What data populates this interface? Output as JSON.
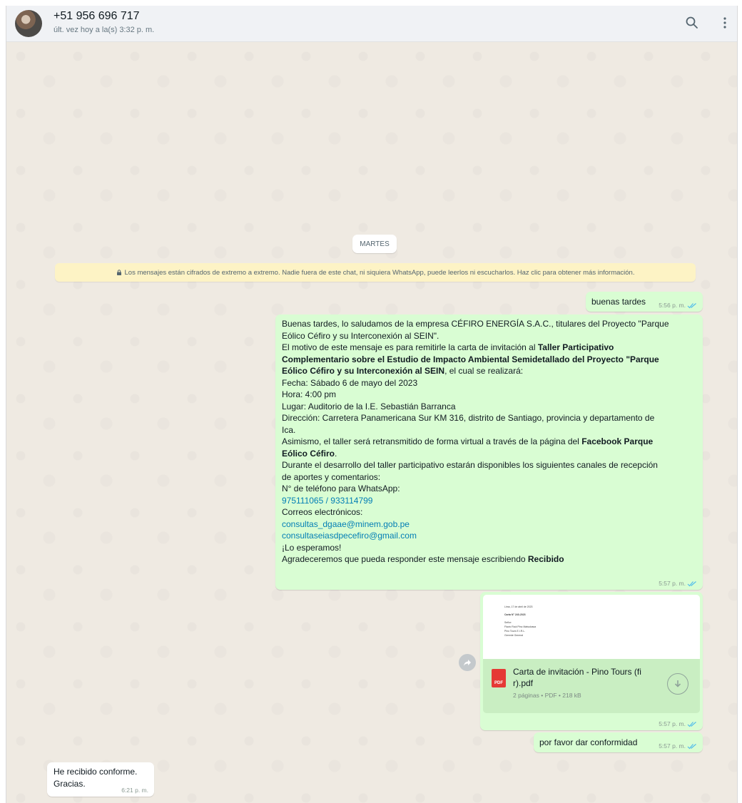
{
  "header": {
    "contact_name": "+51 956 696 717",
    "status": "últ. vez hoy a la(s) 3:32 p. m.",
    "search_icon": "search-icon",
    "menu_icon": "more-vertical-icon"
  },
  "chat": {
    "day_label": "MARTES",
    "encryption_notice": "Los mensajes están cifrados de extremo a extremo. Nadie fuera de este chat, ni siquiera WhatsApp, puede leerlos ni escucharlos. Haz clic para obtener más información.",
    "messages": [
      {
        "text": "buenas tardes",
        "time": "5:56 p. m."
      },
      {
        "lines": [
          "Buenas tardes, lo saludamos de la empresa CÉFIRO ENERGÍA S.A.C., titulares del Proyecto \"Parque",
          "Eólico Céfiro y su Interconexión al SEIN\".",
          "El motivo de este mensaje es para remitirle la carta de invitación al ",
          "Taller Participativo",
          "Complementario sobre el Estudio de Impacto Ambiental Semidetallado del Proyecto \"Parque",
          "Eólico Céfiro y su Interconexión al SEIN",
          ", el cual se realizará:",
          "Fecha: Sábado 6 de mayo del 2023",
          "Hora: 4:00 pm",
          "Lugar:  Auditorio de la I.E. Sebastián Barranca",
          "Dirección: Carretera Panamericana Sur KM 316, distrito de Santiago, provincia y departamento de",
          "Ica.",
          "Asimismo, el taller será retransmitido de forma virtual a través de la página del ",
          "Facebook Parque",
          "Eólico Céfiro",
          ".",
          "Durante el desarrollo del taller participativo estarán disponibles los siguientes canales de recepción",
          "de aportes y comentarios:",
          "N° de teléfono para WhatsApp:",
          "975111065 / 933114799",
          "Correos electrónicos:",
          "consultas_dgaae@minem.gob.pe",
          "consultaseiasdpecefiro@gmail.com",
          "¡Lo esperamos!",
          "Agradeceremos que pueda responder este mensaje escribiendo ",
          "Recibido"
        ],
        "time": "5:57 p. m."
      },
      {
        "document": {
          "name": "Carta de invitación - Pino Tours (fi r).pdf",
          "info": "2 páginas • PDF • 218 kB",
          "icon_label": "PDF",
          "preview_lines": [
            "Lima, 17 de abril de 2023",
            "Carta N° 240-2023",
            "Señor:",
            "Flavio Raúl Pino Matsukawa",
            "Pino Tours E.I.R.L.",
            "Gerente General"
          ]
        },
        "time": "5:57 p. m."
      },
      {
        "text": "por favor dar conformidad",
        "time": "5:57 p. m."
      },
      {
        "lines": [
          "He recibido conforme.",
          "Gracias."
        ],
        "time": "6:21 p. m."
      }
    ]
  },
  "colors": {
    "outgoing_bubble": "#d9fdd3",
    "incoming_bubble": "#ffffff",
    "read_ticks": "#53bdeb",
    "link": "#027eb5",
    "notice_bg": "#fdf3c5"
  }
}
